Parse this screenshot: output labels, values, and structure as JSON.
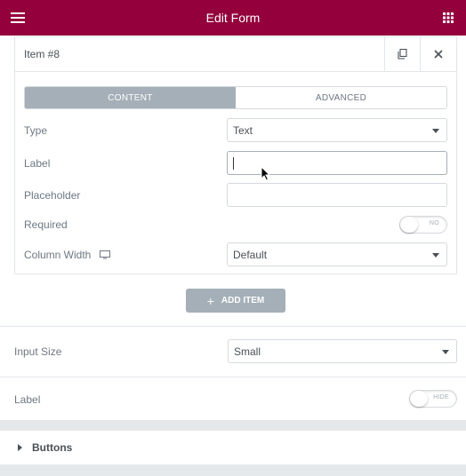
{
  "header": {
    "title": "Edit Form",
    "menu_icon": "hamburger-menu-icon",
    "grid_icon": "apps-grid-icon",
    "color": "#93003c"
  },
  "item": {
    "title": "Item #8",
    "duplicate_icon": "duplicate-icon",
    "close_icon": "close-icon",
    "tabs": {
      "content": "CONTENT",
      "advanced": "ADVANCED",
      "active": "content"
    },
    "fields": {
      "type": {
        "label": "Type",
        "value": "Text"
      },
      "label": {
        "label": "Label",
        "value": ""
      },
      "placeholder": {
        "label": "Placeholder",
        "value": ""
      },
      "required": {
        "label": "Required",
        "toggle_text": "NO",
        "on": false
      },
      "column_width": {
        "label": "Column Width",
        "value": "Default",
        "device_icon": "desktop-icon"
      }
    }
  },
  "add_item": {
    "label": "ADD ITEM",
    "icon": "plus-icon"
  },
  "form_options": {
    "input_size": {
      "label": "Input Size",
      "value": "Small"
    },
    "label": {
      "label": "Label",
      "toggle_text": "HIDE",
      "on": false
    }
  },
  "buttons_section": {
    "title": "Buttons",
    "icon": "caret-right-icon"
  }
}
